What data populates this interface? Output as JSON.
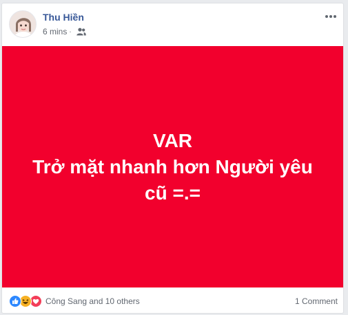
{
  "post": {
    "author": "Thu Hiền",
    "time": "6 mins",
    "separator": "·",
    "audience_icon": "friends-icon",
    "menu_icon": "more-options-icon",
    "background_color": "#f2002d",
    "text_lines": [
      "VAR",
      "Trở mặt nhanh hơn Người yêu",
      "cũ =.="
    ]
  },
  "footer": {
    "reaction_icons": [
      "like-icon",
      "haha-icon",
      "love-icon"
    ],
    "reaction_text": "Công Sang and 10 others",
    "comment_count": "1 Comment"
  }
}
